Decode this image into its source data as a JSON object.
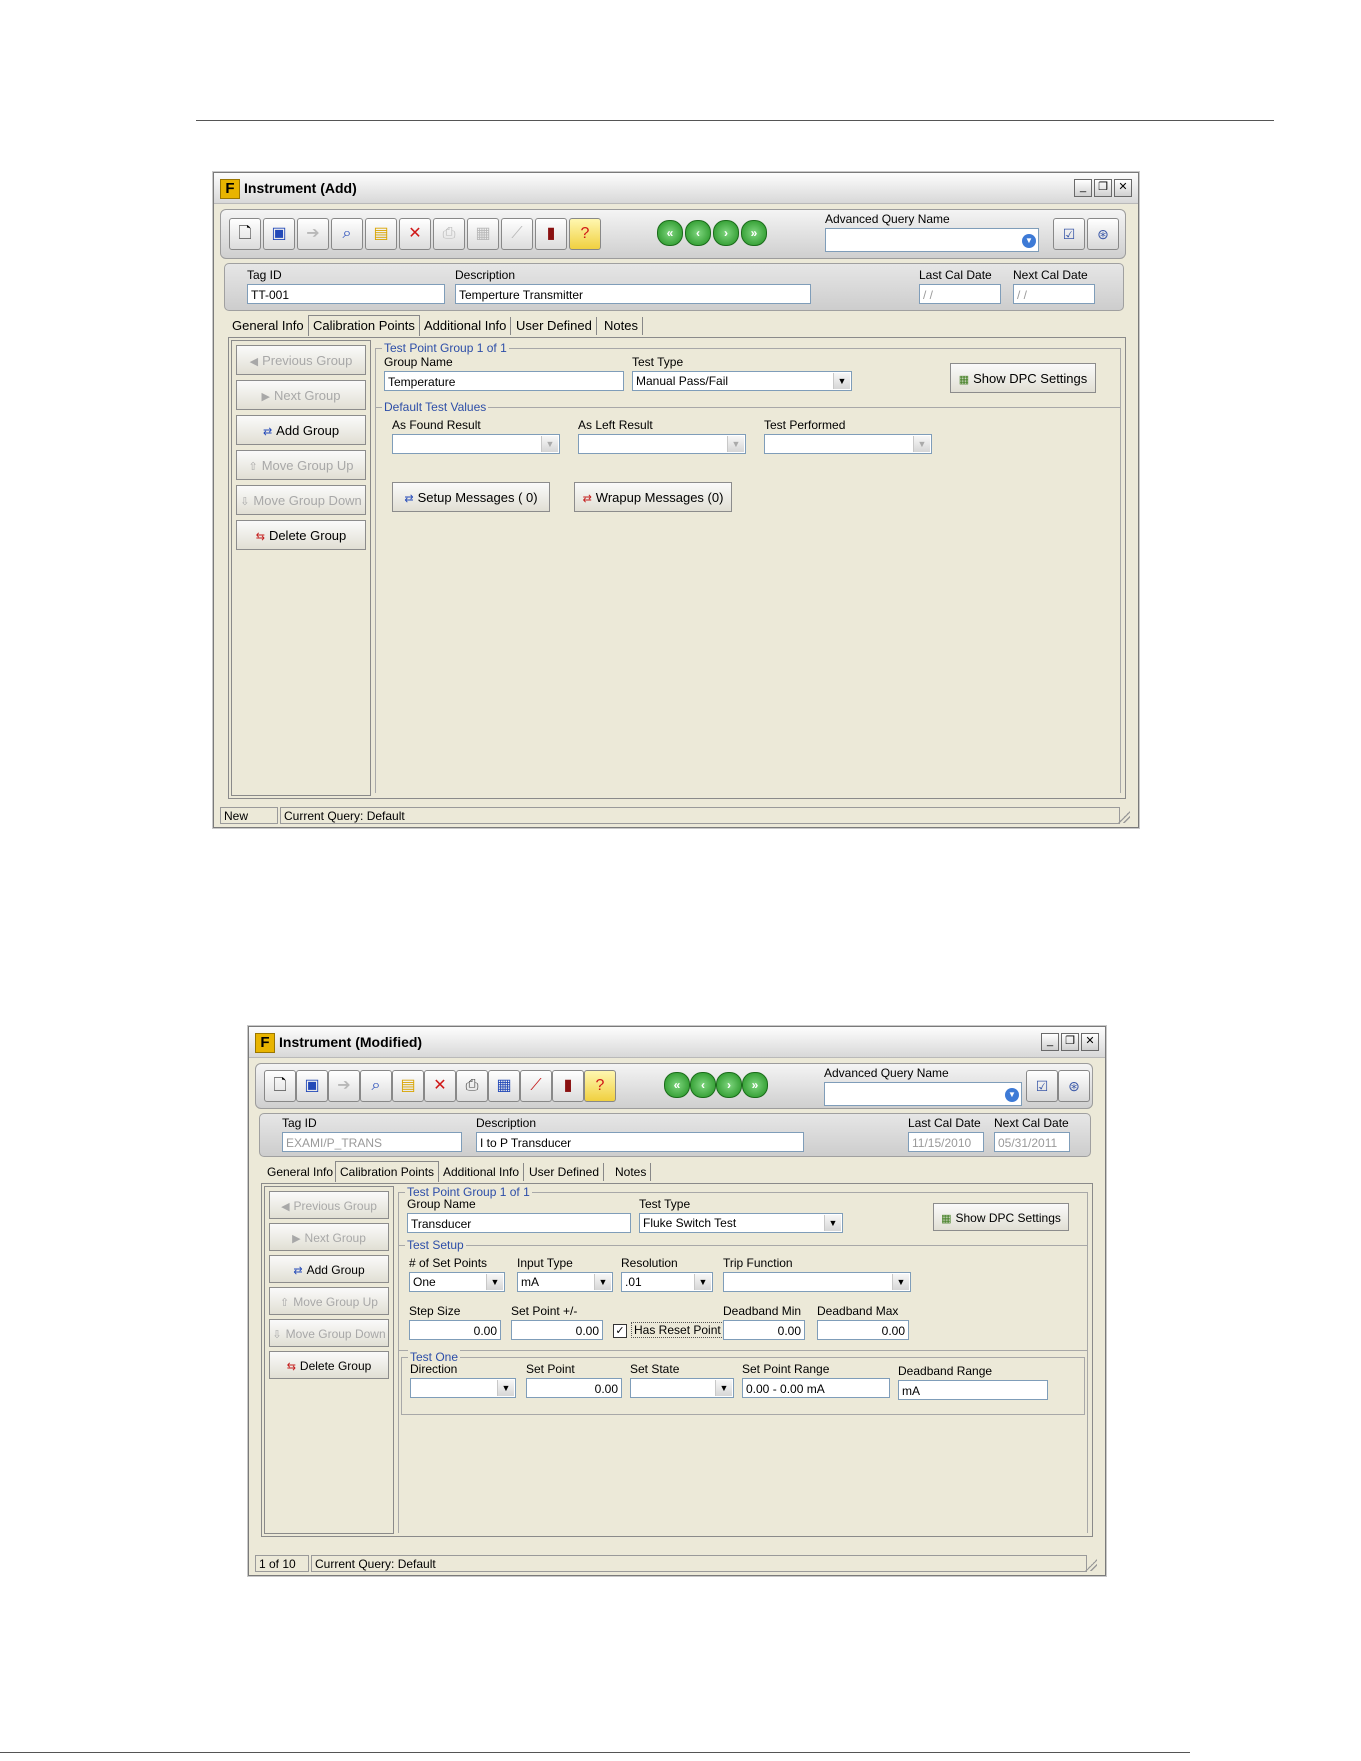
{
  "window1": {
    "title": "Instrument (Add)",
    "aq_label": "Advanced Query Name",
    "tag_id_label": "Tag ID",
    "tag_id": "TT-001",
    "description_label": "Description",
    "description": "Temperture Transmitter",
    "last_cal_label": "Last Cal Date",
    "last_cal": " / /",
    "next_cal_label": "Next Cal Date",
    "next_cal": " / /",
    "tabs": [
      "General Info",
      "Calibration Points",
      "Additional Info",
      "User Defined",
      "Notes"
    ],
    "side": {
      "previous_group": "Previous Group",
      "next_group": "Next Group",
      "add_group": "Add Group",
      "move_up": "Move Group Up",
      "move_down": "Move Group Down",
      "delete_group": "Delete Group"
    },
    "tpg_label": "Test Point Group 1 of 1",
    "group_name_label": "Group Name",
    "group_name": "Temperature",
    "test_type_label": "Test Type",
    "test_type": "Manual Pass/Fail",
    "show_dpc": "Show DPC Settings",
    "dtv_label": "Default Test Values",
    "as_found_label": "As Found Result",
    "as_left_label": "As Left Result",
    "test_performed_label": "Test Performed",
    "setup_messages": "Setup Messages ( 0)",
    "wrapup_messages": "Wrapup Messages (0)",
    "status_left": "New",
    "status_query": "Current Query: Default"
  },
  "window2": {
    "title": "Instrument (Modified)",
    "aq_label": "Advanced Query Name",
    "tag_id_label": "Tag ID",
    "tag_id": "EXAMI/P_TRANS",
    "description_label": "Description",
    "description": "I to P Transducer",
    "last_cal_label": "Last Cal Date",
    "last_cal": "11/15/2010",
    "next_cal_label": "Next Cal Date",
    "next_cal": "05/31/2011",
    "tabs": [
      "General Info",
      "Calibration Points",
      "Additional Info",
      "User Defined",
      "Notes"
    ],
    "side": {
      "previous_group": "Previous Group",
      "next_group": "Next Group",
      "add_group": "Add Group",
      "move_up": "Move Group Up",
      "move_down": "Move Group Down",
      "delete_group": "Delete Group"
    },
    "tpg_label": "Test Point Group 1 of 1",
    "group_name_label": "Group Name",
    "group_name": "Transducer",
    "test_type_label": "Test Type",
    "test_type": "Fluke Switch Test",
    "show_dpc": "Show DPC Settings",
    "test_setup_label": "Test Setup",
    "num_set_points_label": "# of Set Points",
    "num_set_points": "One",
    "input_type_label": "Input Type",
    "input_type": "mA",
    "resolution_label": "Resolution",
    "resolution": ".01",
    "trip_function_label": "Trip Function",
    "trip_function": "",
    "step_size_label": "Step Size",
    "step_size": "0.00",
    "set_point_pm_label": "Set Point +/-",
    "set_point_pm": "0.00",
    "has_reset_point": "Has Reset Point",
    "has_reset_mark": "✓",
    "deadband_min_label": "Deadband Min",
    "deadband_min": "0.00",
    "deadband_max_label": "Deadband Max",
    "deadband_max": "0.00",
    "test_one_label": "Test One",
    "direction_label": "Direction",
    "direction": "",
    "set_point_label": "Set Point",
    "set_point": "0.00",
    "set_state_label": "Set State",
    "set_state": "",
    "set_point_range_label": "Set Point Range",
    "set_point_range": "0.00 - 0.00 mA",
    "deadband_range_label": "Deadband Range",
    "deadband_range": "mA",
    "status_left": "1 of 10",
    "status_query": "Current Query: Default"
  },
  "icons": {
    "new": "new-document-icon",
    "save": "save-icon",
    "export": "export-icon",
    "find": "find-icon",
    "open": "open-folder-icon",
    "delete": "delete-icon",
    "print": "print-icon",
    "report": "report-icon",
    "chart": "chart-icon",
    "calibrator": "calibrator-icon",
    "help": "help-icon"
  },
  "colors": {
    "accent": "#2d4ea8",
    "window_bg": "#ece9d8",
    "logo": "#e8b400"
  }
}
